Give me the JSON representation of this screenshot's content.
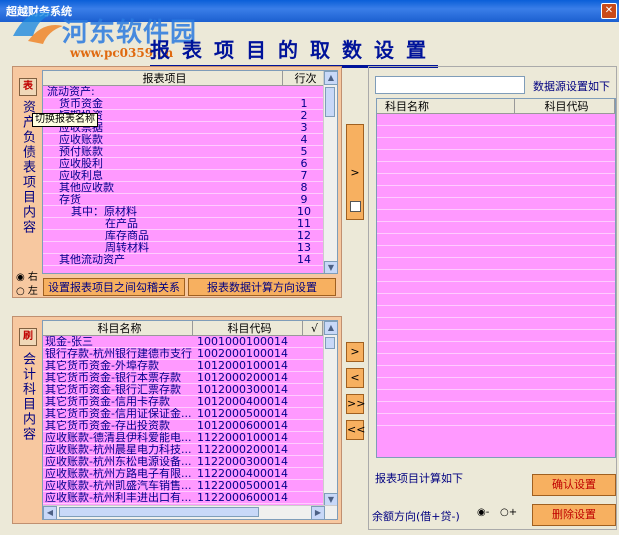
{
  "window": {
    "title": "超越财务系统"
  },
  "watermark": {
    "name": "河东软件园",
    "url": "www.pc0359.cn"
  },
  "heading": "报表项目的取数设置",
  "left_top": {
    "side_label": "资产负债表项目内容",
    "table_icon": "表",
    "tooltip": "切换报表名称",
    "col_name": "报表项目",
    "col_order": "行次",
    "rows": [
      {
        "name": "流动资产:",
        "order": "",
        "indent": 0
      },
      {
        "name": "货币资金",
        "order": "1",
        "indent": 1
      },
      {
        "name": "短期投资",
        "order": "2",
        "indent": 1
      },
      {
        "name": "应收票据",
        "order": "3",
        "indent": 1
      },
      {
        "name": "应收账款",
        "order": "4",
        "indent": 1
      },
      {
        "name": "预付账款",
        "order": "5",
        "indent": 1
      },
      {
        "name": "应收股利",
        "order": "6",
        "indent": 1
      },
      {
        "name": "应收利息",
        "order": "7",
        "indent": 1
      },
      {
        "name": "其他应收款",
        "order": "8",
        "indent": 1
      },
      {
        "name": "存货",
        "order": "9",
        "indent": 1
      },
      {
        "name": "其中：原材料",
        "order": "10",
        "indent": 2
      },
      {
        "name": "在产品",
        "order": "11",
        "indent": 3
      },
      {
        "name": "库存商品",
        "order": "12",
        "indent": 3
      },
      {
        "name": "周转材料",
        "order": "13",
        "indent": 3
      },
      {
        "name": "其他流动资产",
        "order": "14",
        "indent": 1
      }
    ],
    "radio_right": "右",
    "radio_left": "左",
    "btn_relation": "设置报表项目之间勾稽关系",
    "btn_direction": "报表数据计算方向设置"
  },
  "left_bottom": {
    "side_label": "会计科目内容",
    "icon": "刷",
    "col_name": "科目名称",
    "col_code": "科目代码",
    "col_check": "√",
    "rows": [
      {
        "name": "现金-张三",
        "code": "1001000100014"
      },
      {
        "name": "银行存款-杭州银行建德市支行",
        "code": "1002000100014"
      },
      {
        "name": "其它货币资金-外埠存款",
        "code": "1012000100014"
      },
      {
        "name": "其它货币资金-银行本票存款",
        "code": "1012000200014"
      },
      {
        "name": "其它货币资金-银行汇票存款",
        "code": "1012000300014"
      },
      {
        "name": "其它货币资金-信用卡存款",
        "code": "1012000400014"
      },
      {
        "name": "其它货币资金-信用证保证金...",
        "code": "1012000500014"
      },
      {
        "name": "其它货币资金-存出投资款",
        "code": "1012000600014"
      },
      {
        "name": "应收账款-德清县伊科爱能电...",
        "code": "1122000100014"
      },
      {
        "name": "应收账款-杭州晨星电力科技...",
        "code": "1122000200014"
      },
      {
        "name": "应收账款-杭州东松电源设备...",
        "code": "1122000300014"
      },
      {
        "name": "应收账款-杭州方路电子有限...",
        "code": "1122000400014"
      },
      {
        "name": "应收账款-杭州凯盛汽车销售...",
        "code": "1122000500014"
      },
      {
        "name": "应收账款-杭州利丰进出口有...",
        "code": "1122000600014"
      }
    ]
  },
  "middle": {
    "btn_right": ">",
    "btn_add": ">",
    "btn_remove": "<",
    "btn_add_all": ">>",
    "btn_remove_all": "<<"
  },
  "right": {
    "input_value": "",
    "data_source_label": "数据源设置如下",
    "col_name": "科目名称",
    "col_code": "科目代码",
    "calc_label": "报表项目计算如下",
    "balance_label": "余额方向(借+贷-)",
    "radio_minus": "-",
    "radio_plus": "+",
    "btn_confirm": "确认设置",
    "btn_delete": "删除设置"
  }
}
